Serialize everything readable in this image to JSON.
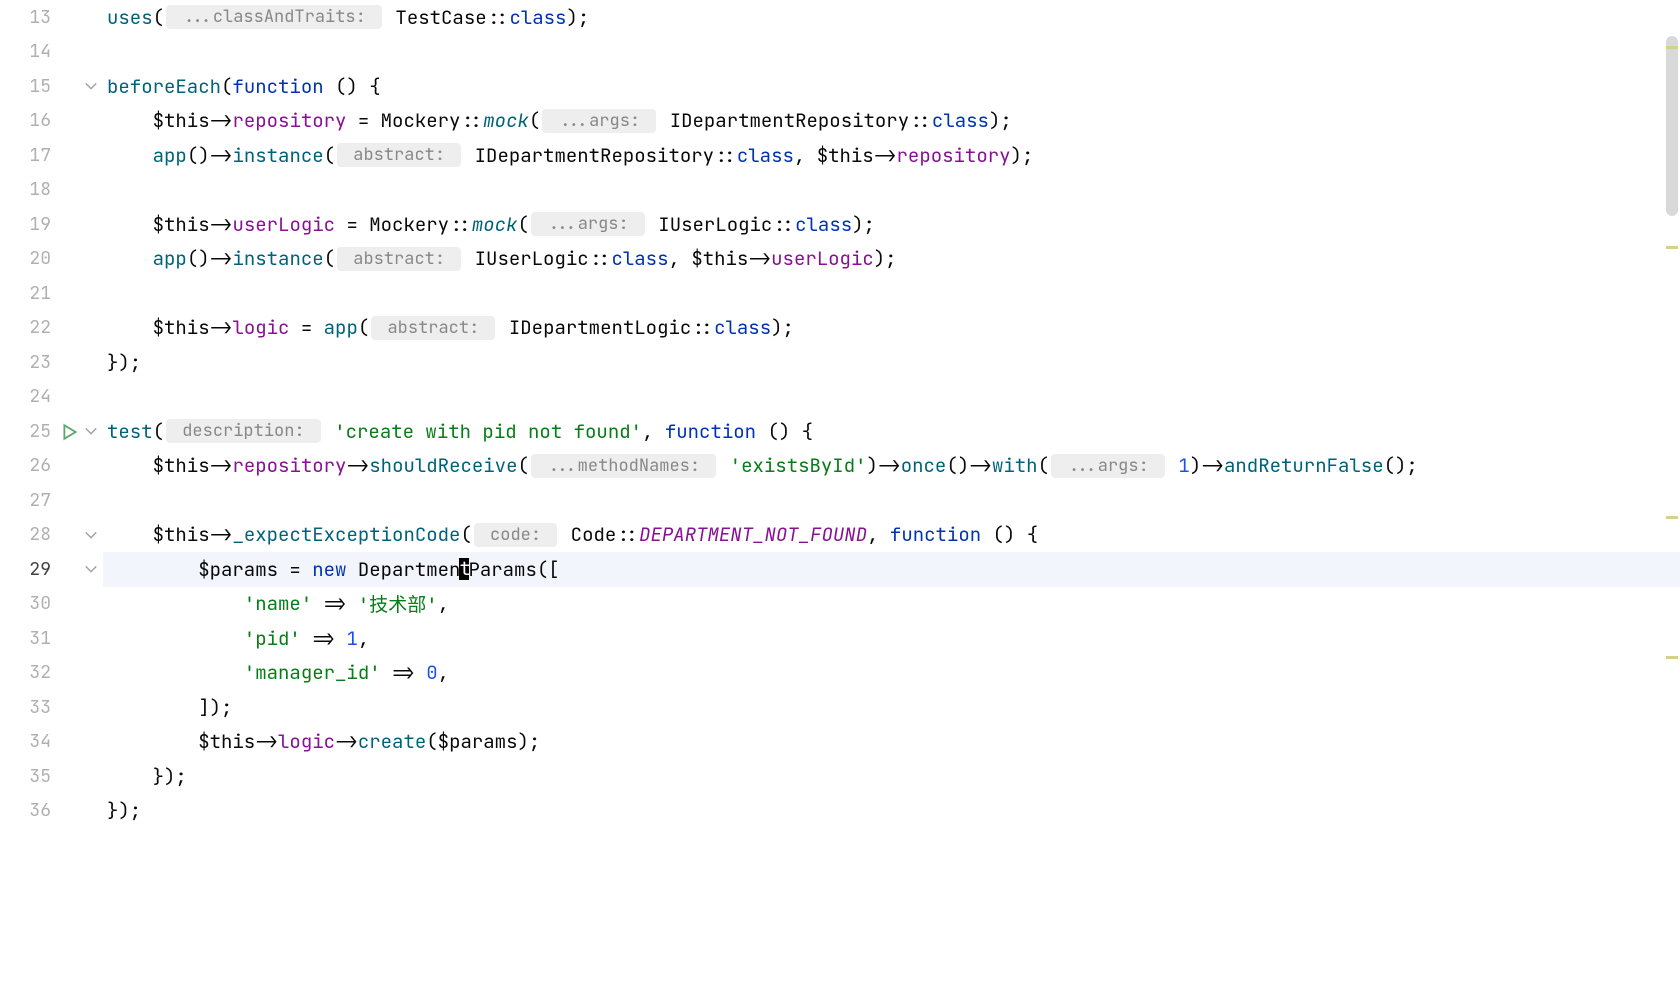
{
  "lineStart": 13,
  "activeLine": 29,
  "tokens": {
    "uses": "uses",
    "hint_classAndTraits": " ...classAndTraits: ",
    "TestCase": "TestCase",
    "dcolon": "::",
    "class_kw": "class",
    "rp_semi": ");",
    "beforeEach": "beforeEach",
    "lp": "(",
    "function": "function",
    "fn_open": " () {",
    "this": "$this",
    "arrow": "->",
    "repository": "repository",
    "eq": " = ",
    "Mockery": "Mockery",
    "mock": "mock",
    "hint_args": " ...args: ",
    "IDepartmentRepository": "IDepartmentRepository",
    "app": "app",
    "empty_call": "()",
    "instance": "instance",
    "hint_abstract": " abstract: ",
    "comma_sp": ", ",
    "userLogic": "userLogic",
    "IUserLogic": "IUserLogic",
    "logic": "logic",
    "IDepartmentLogic": "IDepartmentLogic",
    "close_brace": "});",
    "test": "test",
    "hint_description": " description: ",
    "str_testname": "'create with pid not found'",
    "shouldReceive": "shouldReceive",
    "hint_methodNames": " ...methodNames: ",
    "str_existsById": "'existsById'",
    "once": "once",
    "with": "with",
    "num_1": "1",
    "andReturnFalse": "andReturnFalse",
    "expectExceptionCode": "_expectExceptionCode",
    "hint_code": " code: ",
    "Code": "Code",
    "DEPARTMENT_NOT_FOUND": "DEPARTMENT_NOT_FOUND",
    "params": "$params",
    "new": "new",
    "Departmen": "Departmen",
    "caret_t": "t",
    "Params": "Params",
    "lbrak": "([",
    "str_name": "'name'",
    "fat_arrow": " => ",
    "str_tech": "'技术部'",
    "comma": ",",
    "str_pid": "'pid'",
    "str_manager_id": "'manager_id'",
    "num_0": "0",
    "rbrak": "]);",
    "create": "create",
    "params_var": "$params",
    "close_inner": "});"
  },
  "indents": {
    "i1": "    ",
    "i2": "        ",
    "i3": "            ",
    "i4": "                "
  }
}
